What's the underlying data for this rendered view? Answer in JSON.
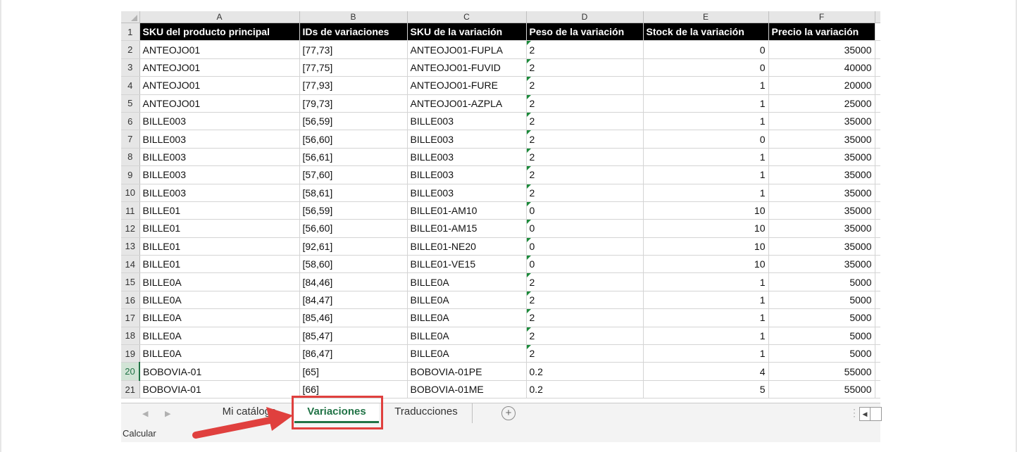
{
  "columns": [
    "A",
    "B",
    "C",
    "D",
    "E",
    "F"
  ],
  "header_row": {
    "row": "1",
    "cells": [
      "SKU del producto principal",
      "IDs de variaciones",
      "SKU de la variación",
      "Peso de la variación",
      "Stock de la variación",
      "Precio la variación"
    ]
  },
  "rows": [
    {
      "row": "2",
      "cells": [
        "ANTEOJO01",
        "[77,73]",
        "ANTEOJO01-FUPLA",
        "2",
        "0",
        "35000"
      ]
    },
    {
      "row": "3",
      "cells": [
        "ANTEOJO01",
        "[77,75]",
        "ANTEOJO01-FUVID",
        "2",
        "0",
        "40000"
      ]
    },
    {
      "row": "4",
      "cells": [
        "ANTEOJO01",
        "[77,93]",
        "ANTEOJO01-FURE",
        "2",
        "1",
        "20000"
      ]
    },
    {
      "row": "5",
      "cells": [
        "ANTEOJO01",
        "[79,73]",
        "ANTEOJO01-AZPLA",
        "2",
        "1",
        "25000"
      ]
    },
    {
      "row": "6",
      "cells": [
        "BILLE003",
        "[56,59]",
        "BILLE003",
        "2",
        "1",
        "35000"
      ]
    },
    {
      "row": "7",
      "cells": [
        "BILLE003",
        "[56,60]",
        "BILLE003",
        "2",
        "0",
        "35000"
      ]
    },
    {
      "row": "8",
      "cells": [
        "BILLE003",
        "[56,61]",
        "BILLE003",
        "2",
        "1",
        "35000"
      ]
    },
    {
      "row": "9",
      "cells": [
        "BILLE003",
        "[57,60]",
        "BILLE003",
        "2",
        "1",
        "35000"
      ]
    },
    {
      "row": "10",
      "cells": [
        "BILLE003",
        "[58,61]",
        "BILLE003",
        "2",
        "1",
        "35000"
      ]
    },
    {
      "row": "11",
      "cells": [
        "BILLE01",
        "[56,59]",
        "BILLE01-AM10",
        "0",
        "10",
        "35000"
      ]
    },
    {
      "row": "12",
      "cells": [
        "BILLE01",
        "[56,60]",
        "BILLE01-AM15",
        "0",
        "10",
        "35000"
      ]
    },
    {
      "row": "13",
      "cells": [
        "BILLE01",
        "[92,61]",
        "BILLE01-NE20",
        "0",
        "10",
        "35000"
      ]
    },
    {
      "row": "14",
      "cells": [
        "BILLE01",
        "[58,60]",
        "BILLE01-VE15",
        "0",
        "10",
        "35000"
      ]
    },
    {
      "row": "15",
      "cells": [
        "BILLE0A",
        "[84,46]",
        "BILLE0A",
        "2",
        "1",
        "5000"
      ]
    },
    {
      "row": "16",
      "cells": [
        "BILLE0A",
        "[84,47]",
        "BILLE0A",
        "2",
        "1",
        "5000"
      ]
    },
    {
      "row": "17",
      "cells": [
        "BILLE0A",
        "[85,46]",
        "BILLE0A",
        "2",
        "1",
        "5000"
      ]
    },
    {
      "row": "18",
      "cells": [
        "BILLE0A",
        "[85,47]",
        "BILLE0A",
        "2",
        "1",
        "5000"
      ]
    },
    {
      "row": "19",
      "cells": [
        "BILLE0A",
        "[86,47]",
        "BILLE0A",
        "2",
        "1",
        "5000"
      ]
    },
    {
      "row": "20",
      "cells": [
        "BOBOVIA-01",
        "[65]",
        "BOBOVIA-01PE",
        "0.2",
        "4",
        "55000"
      ]
    },
    {
      "row": "21",
      "cells": [
        "BOBOVIA-01",
        "[66]",
        "BOBOVIA-01ME",
        "0.2",
        "5",
        "55000"
      ]
    }
  ],
  "tabs": {
    "tab1": "Mi catálogo",
    "tab2": "Variaciones",
    "tab3": "Traducciones"
  },
  "status": "Calcular",
  "selected_row": "20",
  "accent_color": "#217346",
  "annotation_color": "#e0403e"
}
